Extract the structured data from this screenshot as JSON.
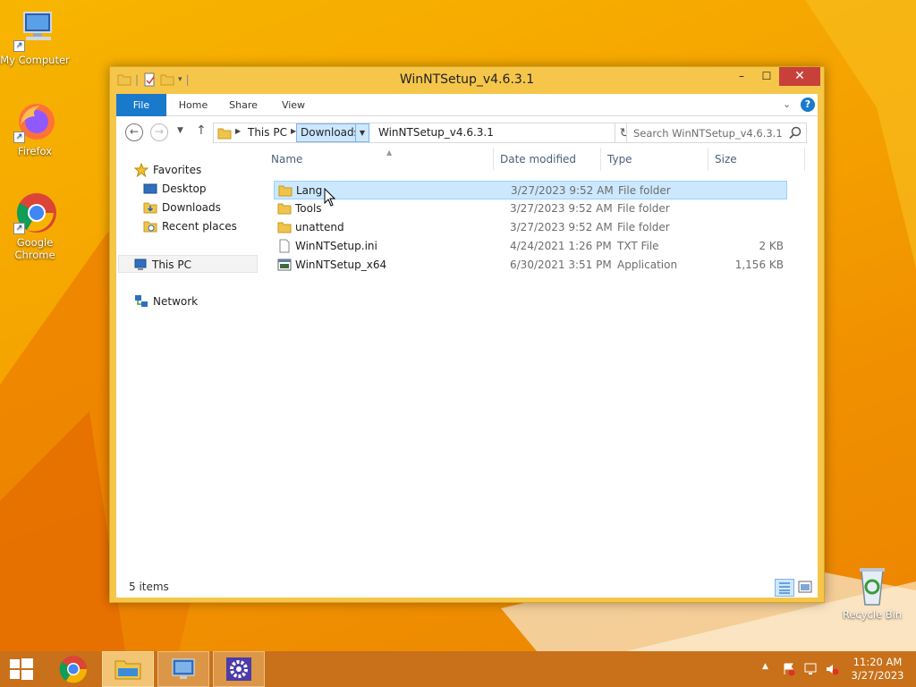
{
  "desktop": {
    "icons": [
      {
        "label": "My Computer"
      },
      {
        "label": "Firefox"
      },
      {
        "label": "Google Chrome"
      },
      {
        "label": "Recycle Bin"
      }
    ]
  },
  "window": {
    "title": "WinNTSetup_v4.6.3.1",
    "controls": {
      "minimize": "–",
      "maximize": "☐",
      "close": "✕"
    },
    "ribbon": {
      "tabs": [
        "File",
        "Home",
        "Share",
        "View"
      ],
      "help": "?"
    },
    "address": {
      "crumbs": [
        "This PC",
        "Downloads",
        "WinNTSetup_v4.6.3.1"
      ]
    },
    "search": {
      "placeholder": "Search WinNTSetup_v4.6.3.1"
    },
    "nav_pane": {
      "favorites": "Favorites",
      "desktop": "Desktop",
      "downloads": "Downloads",
      "recent_places": "Recent places",
      "this_pc": "This PC",
      "network": "Network"
    },
    "columns": {
      "name": "Name",
      "date": "Date modified",
      "type": "Type",
      "size": "Size"
    },
    "files": [
      {
        "name": "Lang",
        "date": "3/27/2023 9:52 AM",
        "type": "File folder",
        "size": "",
        "icon": "folder-icon"
      },
      {
        "name": "Tools",
        "date": "3/27/2023 9:52 AM",
        "type": "File folder",
        "size": "",
        "icon": "folder-icon"
      },
      {
        "name": "unattend",
        "date": "3/27/2023 9:52 AM",
        "type": "File folder",
        "size": "",
        "icon": "folder-icon"
      },
      {
        "name": "WinNTSetup.ini",
        "date": "4/24/2021 1:26 PM",
        "type": "TXT File",
        "size": "2 KB",
        "icon": "text-file-icon"
      },
      {
        "name": "WinNTSetup_x64",
        "date": "6/30/2021 3:51 PM",
        "type": "Application",
        "size": "1,156 KB",
        "icon": "application-icon"
      }
    ],
    "status": "5 items"
  },
  "taskbar": {
    "clock_time": "11:20 AM",
    "clock_date": "3/27/2023"
  }
}
